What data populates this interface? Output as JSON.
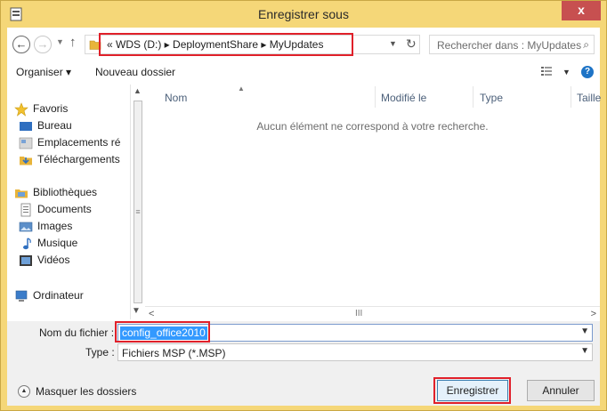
{
  "window": {
    "title": "Enregistrer sous",
    "close_label": "x"
  },
  "address": {
    "path": "« WDS (D:) ▸ DeploymentShare ▸ MyUpdates",
    "search_placeholder": "Rechercher dans : MyUpdates"
  },
  "toolbar": {
    "organize_label": "Organiser ▾",
    "new_folder_label": "Nouveau dossier"
  },
  "sidebar": {
    "items": [
      {
        "label": "Favoris",
        "icon": "star-icon"
      },
      {
        "label": "Bureau",
        "icon": "desktop-icon"
      },
      {
        "label": "Emplacements ré",
        "icon": "recent-places-icon"
      },
      {
        "label": "Téléchargements",
        "icon": "downloads-icon"
      },
      {
        "label": "Bibliothèques",
        "icon": "libraries-icon"
      },
      {
        "label": "Documents",
        "icon": "documents-icon"
      },
      {
        "label": "Images",
        "icon": "images-icon"
      },
      {
        "label": "Musique",
        "icon": "music-icon"
      },
      {
        "label": "Vidéos",
        "icon": "videos-icon"
      },
      {
        "label": "Ordinateur",
        "icon": "computer-icon"
      }
    ]
  },
  "columns": {
    "name": "Nom",
    "modified": "Modifié le",
    "type": "Type",
    "size": "Taille"
  },
  "content": {
    "empty_message": "Aucun élément ne correspond à votre recherche."
  },
  "form": {
    "filename_label": "Nom du fichier :",
    "filename_value": "config_office2010",
    "type_label": "Type :",
    "type_value": "Fichiers MSP (*.MSP)",
    "hide_folders_label": "Masquer les dossiers",
    "save_label": "Enregistrer",
    "cancel_label": "Annuler"
  },
  "colors": {
    "title_bar": "#f5d778",
    "close_button": "#c75050",
    "highlight_red": "#e0202a",
    "selection_blue": "#3399ff"
  }
}
